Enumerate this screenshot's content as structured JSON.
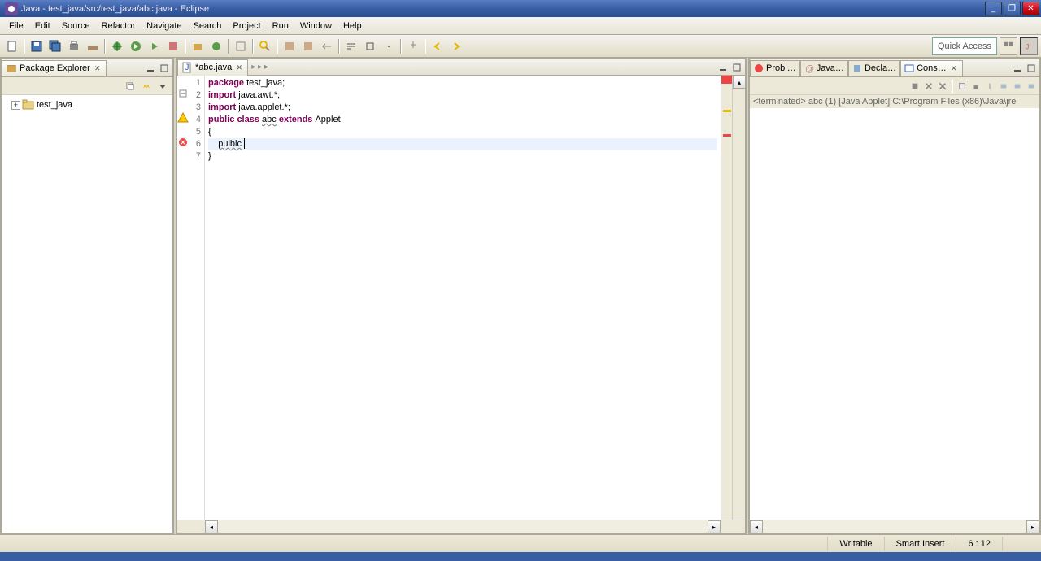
{
  "window": {
    "title": "Java - test_java/src/test_java/abc.java - Eclipse"
  },
  "menu": [
    "File",
    "Edit",
    "Source",
    "Refactor",
    "Navigate",
    "Search",
    "Project",
    "Run",
    "Window",
    "Help"
  ],
  "quick_access": "Quick Access",
  "package_explorer": {
    "title": "Package Explorer",
    "project": "test_java"
  },
  "editor": {
    "tab": "abc.java",
    "lines": [
      {
        "n": 1,
        "seg": [
          {
            "t": "package ",
            "c": "kw"
          },
          {
            "t": "test_java;"
          }
        ]
      },
      {
        "n": 2,
        "seg": [
          {
            "t": "import ",
            "c": "kw"
          },
          {
            "t": "java.awt.*;"
          }
        ],
        "fold": true
      },
      {
        "n": 3,
        "seg": [
          {
            "t": "import ",
            "c": "kw"
          },
          {
            "t": "java.applet.*;"
          }
        ]
      },
      {
        "n": 4,
        "seg": [
          {
            "t": "public class ",
            "c": "kw"
          },
          {
            "t": "abc",
            "c": "sq"
          },
          {
            "t": " extends ",
            "c": "kw"
          },
          {
            "t": "Applet"
          }
        ],
        "warn": true
      },
      {
        "n": 5,
        "seg": [
          {
            "t": "{"
          }
        ]
      },
      {
        "n": 6,
        "seg": [
          {
            "t": "    "
          },
          {
            "t": "pulbic",
            "c": "sq"
          },
          {
            "t": " "
          }
        ],
        "err": true,
        "current": true
      },
      {
        "n": 7,
        "seg": [
          {
            "t": "}"
          }
        ]
      }
    ]
  },
  "right_views": [
    "Probl…",
    "Java…",
    "Decla…",
    "Cons…"
  ],
  "console": {
    "status": "<terminated> abc (1) [Java Applet] C:\\Program Files (x86)\\Java\\jre"
  },
  "status": {
    "writable": "Writable",
    "insert": "Smart Insert",
    "pos": "6 : 12"
  }
}
